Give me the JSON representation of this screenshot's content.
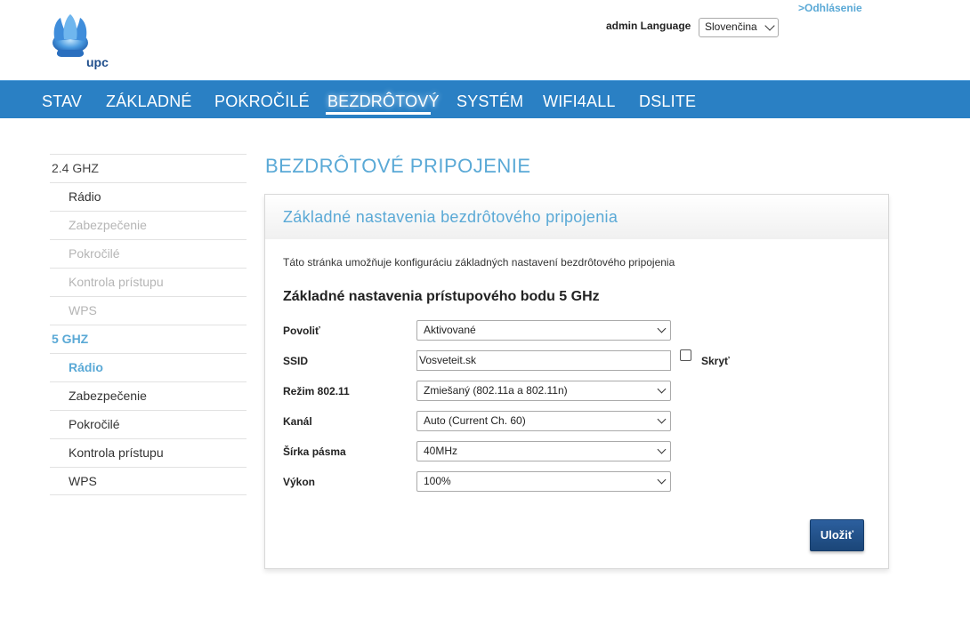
{
  "header": {
    "logo_text": "upc",
    "logout_label": ">Odhlásenie",
    "user_language_label": "admin Language",
    "language_value": "Slovenčina"
  },
  "nav": {
    "items": [
      "STAV",
      "ZÁKLADNÉ",
      "POKROČILÉ",
      "BEZDRÔTOVÝ",
      "SYSTÉM",
      "WIFI4ALL",
      "DSLITE"
    ],
    "active": "BEZDRÔTOVÝ"
  },
  "sidebar": {
    "band_24": {
      "label": "2.4 GHZ",
      "items": [
        "Rádio",
        "Zabezpečenie",
        "Pokročilé",
        "Kontrola prístupu",
        "WPS"
      ]
    },
    "band_5": {
      "label": "5 GHZ",
      "items": [
        "Rádio",
        "Zabezpečenie",
        "Pokročilé",
        "Kontrola prístupu",
        "WPS"
      ]
    }
  },
  "main": {
    "page_title": "BEZDRÔTOVÉ PRIPOJENIE",
    "panel_title": "Základné nastavenia bezdrôtového pripojenia",
    "description": "Táto stránka umožňuje konfiguráciu základných nastavení bezdrôtového pripojenia",
    "section_title": "Základné nastavenia prístupového bodu 5 GHz",
    "fields": {
      "enable": {
        "label": "Povoliť",
        "value": "Aktivované"
      },
      "ssid": {
        "label": "SSID",
        "value": "Vosveteit.sk",
        "hide_label": "Skryť"
      },
      "mode": {
        "label": "Režim 802.11",
        "value": "Zmiešaný (802.11a a 802.11n)"
      },
      "channel": {
        "label": "Kanál",
        "value": "Auto (Current Ch. 60)"
      },
      "bandwidth": {
        "label": "Šírka pásma",
        "value": "40MHz"
      },
      "power": {
        "label": "Výkon",
        "value": "100%"
      }
    },
    "save_label": "Uložiť"
  },
  "colors": {
    "nav_bg": "#2a80c4",
    "accent": "#5aa9d6",
    "button": "#1f4e8c"
  }
}
